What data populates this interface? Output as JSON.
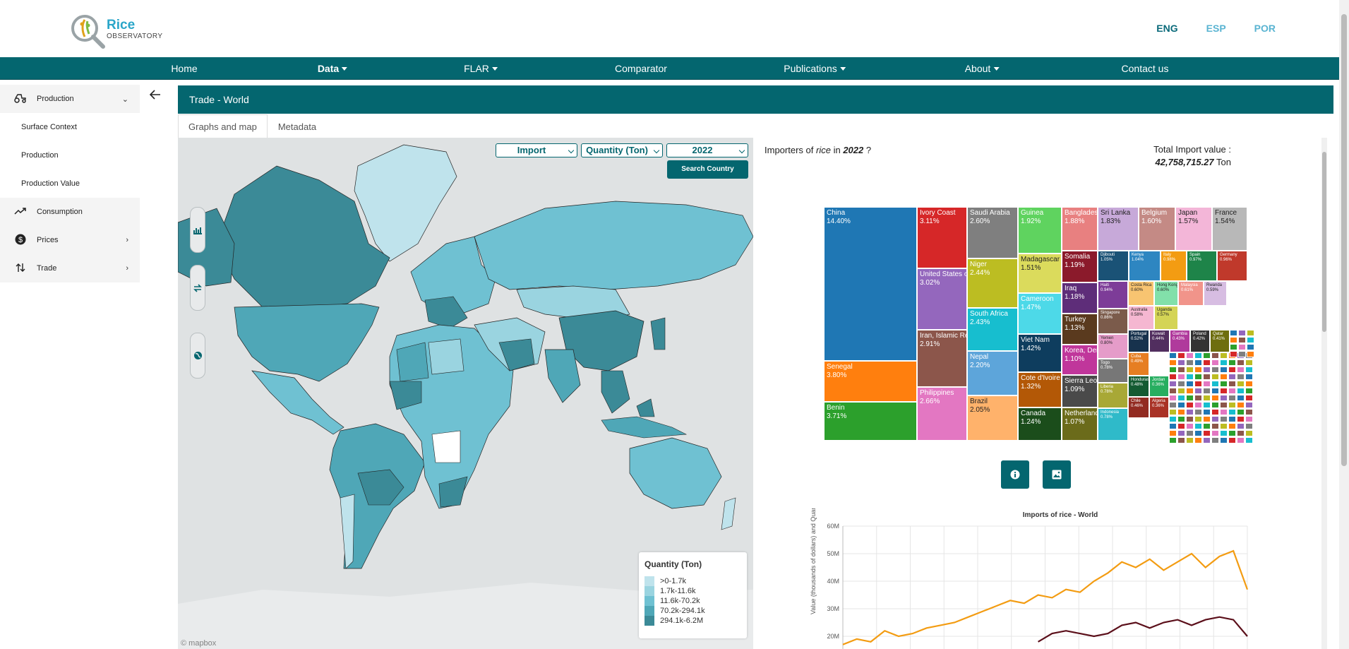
{
  "brand": {
    "name_line1": "Rice",
    "name_line2": "OBSERVATORY"
  },
  "languages": [
    {
      "label": "ENG",
      "active": true
    },
    {
      "label": "ESP",
      "active": false
    },
    {
      "label": "POR",
      "active": false
    }
  ],
  "nav": {
    "home": "Home",
    "data": "Data",
    "flar": "FLAR",
    "comparator": "Comparator",
    "publications": "Publications",
    "about": "About",
    "contact": "Contact us"
  },
  "sidebar": {
    "production": "Production",
    "surface_context": "Surface Context",
    "production_sub": "Production",
    "production_value": "Production Value",
    "consumption": "Consumption",
    "prices": "Prices",
    "trade": "Trade"
  },
  "content": {
    "title": "Trade - World",
    "tabs": [
      "Graphs and map",
      "Metadata"
    ]
  },
  "map": {
    "flow_select": "Import",
    "measure_select": "Quantity (Ton)",
    "year_select": "2022",
    "search_button": "Search Country",
    "legend_title": "Quantity (Ton)",
    "legend": [
      {
        "label": ">0-1.7k",
        "color": "#bfe3ec"
      },
      {
        "label": "1.7k-11.6k",
        "color": "#9ad4e0"
      },
      {
        "label": "11.6k-70.2k",
        "color": "#6fc1d2"
      },
      {
        "label": "70.2k-294.1k",
        "color": "#4fa7b7"
      },
      {
        "label": "294.1k-6.2M",
        "color": "#3b8a97"
      }
    ],
    "attribution": "© mapbox"
  },
  "importers": {
    "title_prefix": "Importers of",
    "commodity": "rice",
    "title_in": "in",
    "year": "2022",
    "title_suffix": "?",
    "total_label": "Total Import value :",
    "total_value": "42,758,715.27",
    "total_unit": "Ton"
  },
  "treemap": [
    {
      "name": "China",
      "pct": "14.40%",
      "color": "#1f77b4"
    },
    {
      "name": "Senegal",
      "pct": "3.80%",
      "color": "#ff7f0e"
    },
    {
      "name": "Benin",
      "pct": "3.71%",
      "color": "#2ca02c"
    },
    {
      "name": "Ivory Coast",
      "pct": "3.11%",
      "color": "#d62728"
    },
    {
      "name": "United States of America",
      "pct": "3.02%",
      "color": "#9467bd"
    },
    {
      "name": "Iran, Islamic Republic of",
      "pct": "2.91%",
      "color": "#8c564b"
    },
    {
      "name": "Philippines",
      "pct": "2.66%",
      "color": "#e377c2"
    },
    {
      "name": "Saudi Arabia",
      "pct": "2.60%",
      "color": "#7f7f7f"
    },
    {
      "name": "Niger",
      "pct": "2.44%",
      "color": "#bcbd22"
    },
    {
      "name": "South Africa",
      "pct": "2.43%",
      "color": "#17becf"
    },
    {
      "name": "Nepal",
      "pct": "2.20%",
      "color": "#5da5da"
    },
    {
      "name": "Brazil",
      "pct": "2.05%",
      "color": "#ffb26b"
    },
    {
      "name": "Guinea",
      "pct": "1.92%",
      "color": "#5fd35f"
    },
    {
      "name": "Madagascar",
      "pct": "1.51%",
      "color": "#dbdb5c"
    },
    {
      "name": "Cameroon",
      "pct": "1.47%",
      "color": "#4dd9e8"
    },
    {
      "name": "Viet Nam",
      "pct": "1.42%",
      "color": "#0e3d5e"
    },
    {
      "name": "Cote d'Ivoire",
      "pct": "1.32%",
      "color": "#b35806"
    },
    {
      "name": "Canada",
      "pct": "1.24%",
      "color": "#1b4d1b"
    },
    {
      "name": "Bangladesh",
      "pct": "1.88%",
      "color": "#e88080"
    },
    {
      "name": "Somalia",
      "pct": "1.19%",
      "color": "#8b1a2b"
    },
    {
      "name": "Iraq",
      "pct": "1.18%",
      "color": "#5e2d79"
    },
    {
      "name": "Turkey",
      "pct": "1.13%",
      "color": "#5a3a1e"
    },
    {
      "name": "Korea, Democratic People's Republic of",
      "pct": "1.10%",
      "color": "#c0369b"
    },
    {
      "name": "Sierra Leone",
      "pct": "1.09%",
      "color": "#4a4a4a"
    },
    {
      "name": "Netherlands",
      "pct": "1.07%",
      "color": "#6b6b1a"
    },
    {
      "name": "Sri Lanka",
      "pct": "1.83%",
      "color": "#c7a9d9"
    },
    {
      "name": "Belgium",
      "pct": "1.60%",
      "color": "#c48a85"
    },
    {
      "name": "Japan",
      "pct": "1.57%",
      "color": "#f3b6d8"
    },
    {
      "name": "France",
      "pct": "1.54%",
      "color": "#b8b8b8"
    },
    {
      "name": "Djibouti",
      "pct": "1.05%",
      "color": "#1a5276"
    },
    {
      "name": "Kenya",
      "pct": "1.04%",
      "color": "#2e86c1"
    },
    {
      "name": "Italy",
      "pct": "0.98%",
      "color": "#f39c12"
    },
    {
      "name": "Spain",
      "pct": "0.97%",
      "color": "#1e8449"
    },
    {
      "name": "Germany",
      "pct": "0.96%",
      "color": "#c0392b"
    },
    {
      "name": "Haiti",
      "pct": "0.94%",
      "color": "#7d3c98"
    },
    {
      "name": "Singapore",
      "pct": "0.86%",
      "color": "#7b5b4b"
    },
    {
      "name": "Yemen",
      "pct": "0.80%",
      "color": "#e59cc9"
    },
    {
      "name": "Togo",
      "pct": "0.78%",
      "color": "#777777"
    },
    {
      "name": "Liberia",
      "pct": "0.78%",
      "color": "#a8a836"
    },
    {
      "name": "Indonesia",
      "pct": "0.78%",
      "color": "#2fbac9"
    },
    {
      "name": "Costa Rica",
      "pct": "0.60%",
      "color": "#f8c471"
    },
    {
      "name": "Hong Kong",
      "pct": "0.60%",
      "color": "#82e0aa"
    },
    {
      "name": "Malaysia",
      "pct": "0.61%",
      "color": "#f1948a"
    },
    {
      "name": "Rwanda",
      "pct": "0.59%",
      "color": "#d7bde2"
    },
    {
      "name": "Australia",
      "pct": "0.58%",
      "color": "#f5b7d1"
    },
    {
      "name": "Uganda",
      "pct": "0.57%",
      "color": "#d4d455"
    },
    {
      "name": "Portugal",
      "pct": "0.52%",
      "color": "#17324d"
    },
    {
      "name": "Kuwait",
      "pct": "0.44%",
      "color": "#512e5f"
    },
    {
      "name": "Gambia",
      "pct": "0.43%",
      "color": "#b03a9c"
    },
    {
      "name": "Poland",
      "pct": "0.42%",
      "color": "#333333"
    },
    {
      "name": "Qatar",
      "pct": "0.41%",
      "color": "#6e6e0e"
    },
    {
      "name": "Cuba",
      "pct": "0.49%",
      "color": "#e67e22"
    },
    {
      "name": "Honduras",
      "pct": "0.48%",
      "color": "#145a32"
    },
    {
      "name": "Jordan",
      "pct": "0.36%",
      "color": "#27ae60"
    },
    {
      "name": "Chile",
      "pct": "0.46%",
      "color": "#922b21"
    },
    {
      "name": "Algeria",
      "pct": "0.36%",
      "color": "#a93226"
    }
  ],
  "line_chart": {
    "title": "Imports of rice - World",
    "ylabel": "Value (thousands of dollars) and Quantity (ton)",
    "ytick_labels": [
      "60M",
      "50M",
      "40M",
      "30M",
      "20M"
    ]
  },
  "chart_data": {
    "type": "line",
    "title": "Imports of rice - World",
    "ylabel": "Value (thousands of dollars) and Quantity (ton)",
    "ylim": [
      18000000,
      60000000
    ],
    "series": [
      {
        "color": "#f39c12",
        "values": [
          17,
          19,
          18,
          22,
          20,
          21,
          23,
          24,
          25,
          27,
          29,
          31,
          33,
          32,
          35,
          34,
          37,
          36,
          40,
          43,
          47,
          45,
          48,
          44,
          47,
          50,
          45,
          49,
          51,
          37
        ]
      },
      {
        "color": "#5b0f1a",
        "values": [
          null,
          null,
          null,
          null,
          null,
          null,
          null,
          null,
          null,
          null,
          null,
          null,
          null,
          null,
          18,
          21,
          22,
          21,
          20,
          21,
          24,
          25,
          23,
          25,
          26,
          24,
          26,
          27,
          26,
          20
        ]
      }
    ]
  }
}
